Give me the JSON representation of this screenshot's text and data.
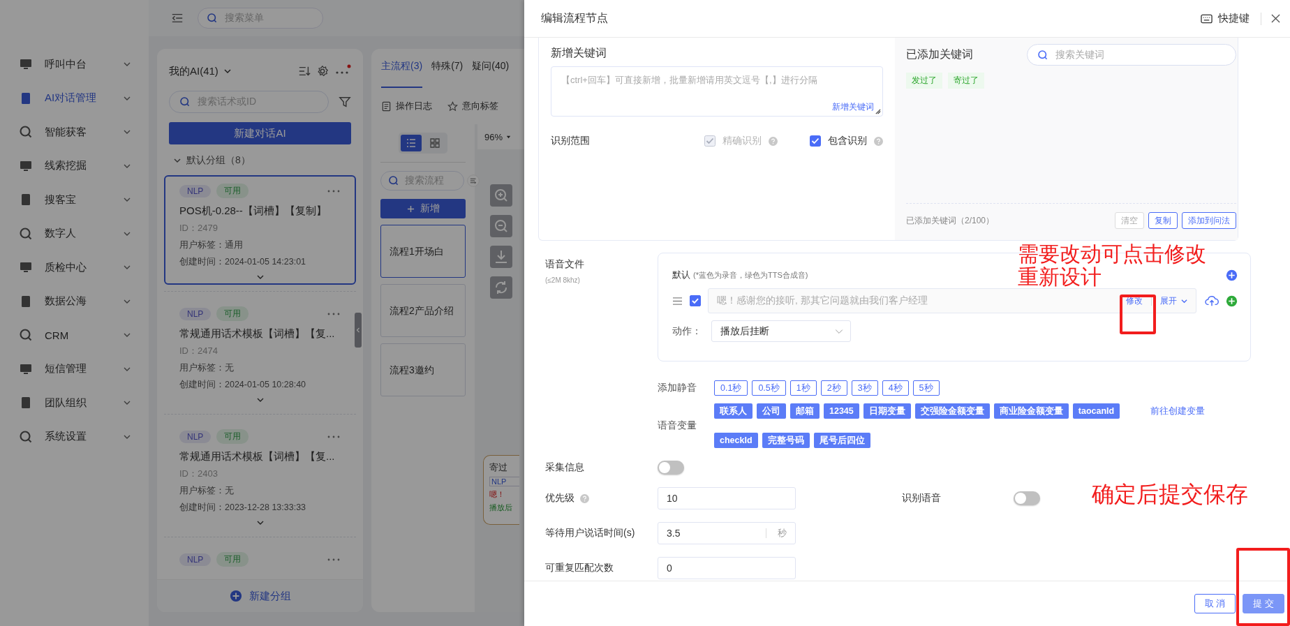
{
  "header": {
    "search_placeholder": "搜索菜单"
  },
  "sidebar": {
    "items": [
      {
        "label": "呼叫中台",
        "selected": false
      },
      {
        "label": "AI对话管理",
        "selected": true
      },
      {
        "label": "智能获客",
        "selected": false
      },
      {
        "label": "线索挖掘",
        "selected": false
      },
      {
        "label": "搜客宝",
        "selected": false
      },
      {
        "label": "数字人",
        "selected": false
      },
      {
        "label": "质检中心",
        "selected": false
      },
      {
        "label": "数据公海",
        "selected": false
      },
      {
        "label": "CRM",
        "selected": false
      },
      {
        "label": "短信管理",
        "selected": false
      },
      {
        "label": "团队组织",
        "selected": false
      },
      {
        "label": "系统设置",
        "selected": false
      }
    ]
  },
  "ai_panel": {
    "title": "我的AI(41)",
    "search_placeholder": "搜索话术或ID",
    "new_button": "新建对话AI",
    "group": {
      "label": "默认分组（8）",
      "expanded": true
    },
    "cards": [
      {
        "tags": [
          "NLP",
          "可用"
        ],
        "name": "POS机-0.28--【词槽】【复制】",
        "id": "ID：2479",
        "user_tag": "用户标签：通用",
        "created": "创建时间：2024-01-05 14:23:01",
        "selected": true
      },
      {
        "tags": [
          "NLP",
          "可用"
        ],
        "name": "常规通用话术模板【词槽】【复...",
        "id": "ID：2474",
        "user_tag": "用户标签：无",
        "created": "创建时间：2024-01-05 10:28:40",
        "selected": false
      },
      {
        "tags": [
          "NLP",
          "可用"
        ],
        "name": "常规通用话术模板【词槽】【复...",
        "id": "ID：2403",
        "user_tag": "用户标签：无",
        "created": "创建时间：2023-12-28 13:33:33",
        "selected": false
      },
      {
        "tags": [
          "NLP",
          "可用"
        ],
        "selected": false
      }
    ],
    "add_group": "新建分组"
  },
  "flow_panel": {
    "tabs": [
      {
        "label": "主流程(3)",
        "selected": true
      },
      {
        "label": "特殊(7)",
        "selected": false
      },
      {
        "label": "疑问(40)",
        "selected": false
      }
    ],
    "tools": [
      "操作日志",
      "意向标签"
    ],
    "search_placeholder": "搜索流程",
    "add_button": "新增",
    "flows": [
      {
        "label": "流程1开场白",
        "selected": true
      },
      {
        "label": "流程2产品介绍",
        "selected": false
      },
      {
        "label": "流程3邀约",
        "selected": false
      }
    ],
    "view_modes": [
      {
        "selected": true
      },
      {
        "selected": false
      }
    ],
    "zoom": "96%",
    "node": {
      "title": "寄过",
      "tag": "NLP",
      "text": "嗯！",
      "action": "播放后"
    }
  },
  "drawer": {
    "title": "编辑流程节点",
    "shortcut": "快捷键",
    "keywords": {
      "title": "新增关键词",
      "placeholder": "【ctrl+回车】可直接新增，批量新增请用英文逗号【,】进行分隔",
      "add_link": "新增关键词",
      "scope_label": "识别范围",
      "scope_options": [
        {
          "label": "精确识别",
          "checked": true,
          "disabled": true
        },
        {
          "label": "包含识别",
          "checked": true,
          "disabled": false
        }
      ],
      "added_title": "已添加关键词",
      "search_placeholder": "搜索关键词",
      "tags": [
        "发过了",
        "寄过了"
      ],
      "count": "已添加关键词（2/100）",
      "actions": [
        {
          "label": "清空",
          "disabled": true
        },
        {
          "label": "复制",
          "disabled": false
        },
        {
          "label": "添加到问法",
          "disabled": false
        }
      ]
    },
    "voice": {
      "label": "语音文件",
      "hint": "(≤2M 8khz)",
      "default_label": "默认",
      "default_hint": "(*蓝色为录音，绿色为TTS合成音)",
      "files": [
        {
          "checked": true,
          "text": "嗯！感谢您的接听, 那其它问题就由我们客户经理",
          "edit": "修改",
          "expand": "展开"
        }
      ],
      "action_label": "动作：",
      "action_value": "播放后挂断"
    },
    "silence": {
      "label": "添加静音",
      "options": [
        "0.1秒",
        "0.5秒",
        "1秒",
        "2秒",
        "3秒",
        "4秒",
        "5秒"
      ]
    },
    "variables": {
      "label": "语音变量",
      "items": [
        "联系人",
        "公司",
        "邮箱",
        "12345",
        "日期变量",
        "交强险金额变量",
        "商业险金额变量",
        "taocanId",
        "checkId",
        "完整号码",
        "尾号后四位"
      ],
      "create_link": "前往创建变量"
    },
    "collect": {
      "label": "采集信息",
      "on": false
    },
    "priority": {
      "label": "优先级",
      "value": "10"
    },
    "recognize_voice": {
      "label": "识别语音",
      "on": false
    },
    "wait_time": {
      "label": "等待用户说话时间(s)",
      "value": "3.5",
      "suffix": "秒"
    },
    "repeat": {
      "label": "可重复匹配次数",
      "value": "0"
    },
    "buttons": [
      {
        "label": "取 消",
        "kind": "secondary"
      },
      {
        "label": "提 交",
        "kind": "primary"
      }
    ]
  },
  "annotations": [
    {
      "lines": [
        "需要改动可点击修改",
        "重新设计"
      ]
    },
    {
      "lines": [
        "确定后提交保存"
      ]
    }
  ]
}
